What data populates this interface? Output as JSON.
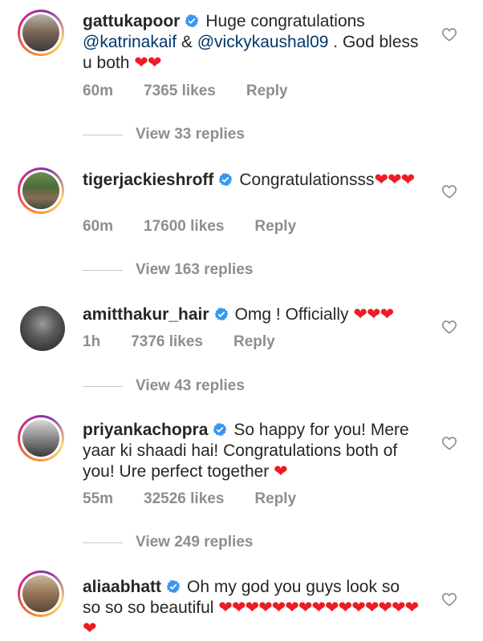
{
  "comments": [
    {
      "username": "gattukapoor",
      "body": "Huge congratulations ",
      "mention1": "@katrinakaif",
      "amp": " & ",
      "mention2": "@vickykaushal09",
      "body2": " . God bless u both ",
      "hearts": "❤❤",
      "time": "60m",
      "likes": "7365 likes",
      "reply": "Reply",
      "view_replies": "View 33 replies"
    },
    {
      "username": "tigerjackieshroff",
      "body": "Congratulationsss",
      "hearts": "❤❤❤",
      "time": "60m",
      "likes": "17600 likes",
      "reply": "Reply",
      "view_replies": "View 163 replies"
    },
    {
      "username": "amitthakur_hair",
      "body": "Omg ! Officially ",
      "hearts": "❤❤❤",
      "time": "1h",
      "likes": "7376 likes",
      "reply": "Reply",
      "view_replies": "View 43 replies"
    },
    {
      "username": "priyankachopra",
      "body": "So happy for you! Mere yaar ki shaadi hai! Congratulations both of you! Ure perfect together ",
      "hearts": "❤",
      "time": "55m",
      "likes": "32526 likes",
      "reply": "Reply",
      "view_replies": "View 249 replies"
    },
    {
      "username": "aliaabhatt",
      "body": "Oh my god you guys look so so so so beautiful ",
      "hearts": "❤❤❤❤❤❤❤❤❤❤❤❤❤❤❤❤",
      "time": "",
      "likes": "",
      "reply": "",
      "view_replies": ""
    }
  ],
  "colors": {
    "verified": "#3897f0",
    "mention": "#00376b",
    "heart": "#ed1c24",
    "meta": "#8e8e8e"
  },
  "icons": {
    "verified": "verified-badge-icon",
    "like": "heart-outline-icon"
  }
}
